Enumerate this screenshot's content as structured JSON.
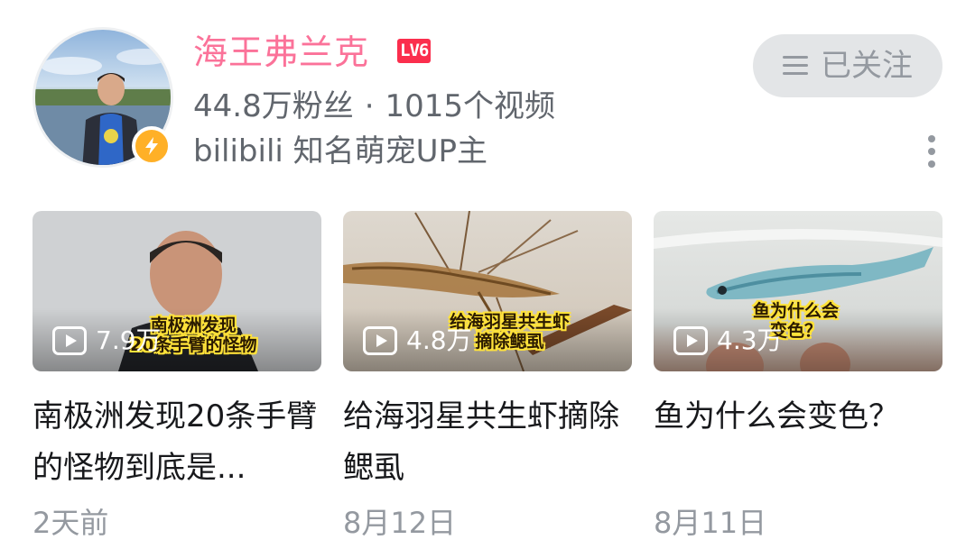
{
  "header": {
    "username": "海王弗兰克",
    "level_badge": "LV6",
    "fans": "44.8万粉丝",
    "separator": "·",
    "videos": "1015个视频",
    "description": "bilibili 知名萌宠UP主",
    "follow_label": "已关注"
  },
  "videos": [
    {
      "views": "7.9万",
      "caption_line1": "南极洲发现",
      "caption_line2": "20条手臂的怪物",
      "title": "南极洲发现20条手臂的怪物到底是...",
      "date": "2天前"
    },
    {
      "views": "4.8万",
      "caption_line1": "给海羽星共生虾",
      "caption_line2": "摘除鳃虱",
      "title": "给海羽星共生虾摘除鳃虱",
      "date": "8月12日"
    },
    {
      "views": "4.3万",
      "caption_line1": "鱼为什么会",
      "caption_line2": "变色？",
      "title": "鱼为什么会变色？",
      "date": "8月11日"
    }
  ],
  "colors": {
    "accent_pink": "#fb7299",
    "level_red": "#fb2e4d",
    "badge_yellow": "#ffb027",
    "muted_text": "#61666d",
    "date_text": "#9499a0"
  },
  "icons": [
    "lightning-badge-icon",
    "menu-lines-icon",
    "more-vertical-icon",
    "play-icon"
  ]
}
